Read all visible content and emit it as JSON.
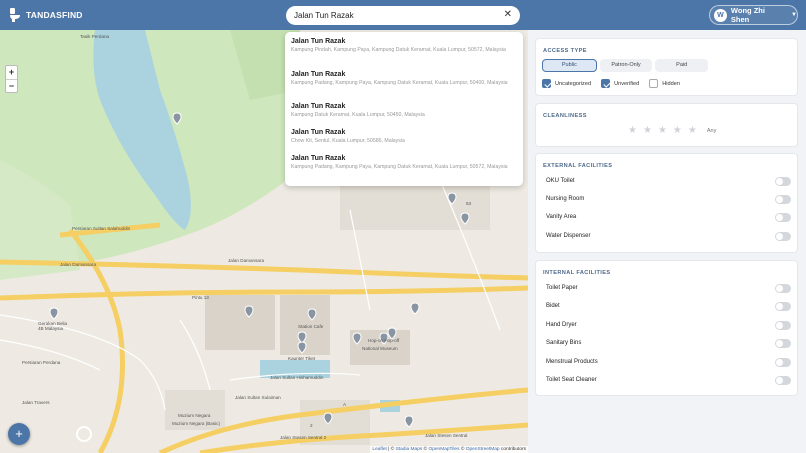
{
  "app": {
    "name": "TANDASFIND"
  },
  "search": {
    "value": "Jalan Tun Razak",
    "clear_icon": "close-icon"
  },
  "user": {
    "initial": "W",
    "name": "Wong Zhi Shen"
  },
  "suggestions": [
    {
      "title": "Jalan Tun Razak",
      "address": "Kampung Pindah, Kampung Paya, Kampung Datuk Keramat, Kuala Lumpur, 50572, Malaysia"
    },
    {
      "title": "Jalan Tun Razak",
      "address": "Kampung Padang, Kampung Paya, Kampung Datuk Keramat, Kuala Lumpur, 50400, Malaysia"
    },
    {
      "title": "Jalan Tun Razak",
      "address": "Kampung Datuk Keramat, Kuala Lumpur, 50450, Malaysia"
    },
    {
      "title": "Jalan Tun Razak",
      "address": "Chow Kit, Sentul, Kuala Lumpur, 50586, Malaysia"
    },
    {
      "title": "Jalan Tun Razak",
      "address": "Kampung Padang, Kampung Paya, Kampung Datuk Keramat, Kuala Lumpur, 50572, Malaysia"
    }
  ],
  "map": {
    "zoom_in": "+",
    "zoom_out": "−",
    "add": "+",
    "labels": {
      "lake": "Tasik Perdana",
      "road1": "Persiaran Sultan Salahuddin",
      "road2": "Jalan Damansara",
      "road3": "Jalan Damansara",
      "road4": "Jalan Sultan Hishamuddin",
      "road5": "Jalan Sultan Sulaiman",
      "road6": "Jalan Travers",
      "road7": "Jalan Stesen Sentral",
      "road8": "Jalan Stesen Sentral 2",
      "road9": "Persiaran Perdana",
      "road10": "Pintu 13",
      "poi1": "Station Cafe",
      "poi2": "Kaunter Tiket",
      "poi3": "Muzium Negara",
      "poi4": "National Museum",
      "poi5": "Gerakan Belia 4B Malaysia",
      "poi6": "Muzium Negara (Basic)",
      "poi7": "Hop-on Hop-off",
      "num1": "53",
      "num2": "A",
      "num3": "2"
    },
    "attribution": {
      "leaflet": "Leaflet",
      "stadia": "Stadia Maps",
      "omt": "OpenMapTiles",
      "osm": "OpenStreetMap",
      "suffix": "contributors"
    }
  },
  "filters": {
    "access": {
      "title": "ACCESS TYPE",
      "options": [
        "Public",
        "Patron-Only",
        "Paid"
      ],
      "selected": "Public",
      "checks": [
        {
          "label": "Uncategorized",
          "checked": true
        },
        {
          "label": "Unverified",
          "checked": true
        },
        {
          "label": "Hidden",
          "checked": false
        }
      ]
    },
    "cleanliness": {
      "title": "CLEANLINESS",
      "stars": 5,
      "any_label": "Any"
    },
    "external": {
      "title": "EXTERNAL FACILITIES",
      "items": [
        "OKU Toilet",
        "Nursing Room",
        "Vanity Area",
        "Water Dispenser"
      ]
    },
    "internal": {
      "title": "INTERNAL FACILITIES",
      "items": [
        "Toilet Paper",
        "Bidet",
        "Hand Dryer",
        "Sanitary Bins",
        "Menstrual Products",
        "Toilet Seat Cleaner"
      ]
    }
  },
  "colors": {
    "header": "#4d76a8",
    "accent": "#4d76a8",
    "road": "#f7d36b",
    "water": "#aad3df",
    "park": "#c8e6b4"
  }
}
